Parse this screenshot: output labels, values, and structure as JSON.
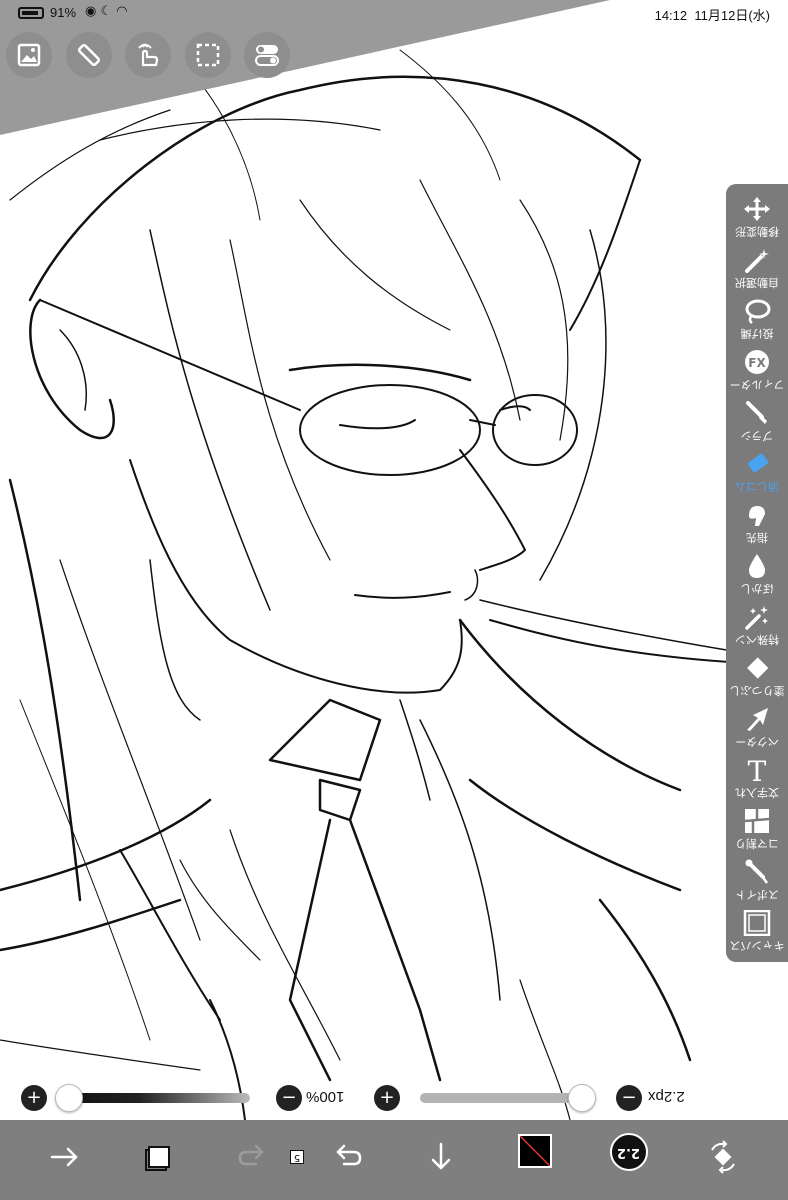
{
  "status_bar": {
    "battery_percent": "91%",
    "time": "14:12",
    "date": "11月12日(水)"
  },
  "top_tools": [
    {
      "name": "image-icon"
    },
    {
      "name": "ruler-icon"
    },
    {
      "name": "gesture-icon"
    },
    {
      "name": "selection-icon"
    },
    {
      "name": "toggle-icon"
    }
  ],
  "right_toolbar": {
    "items": [
      {
        "label": "移動変形",
        "icon": "move-icon"
      },
      {
        "label": "自動選択",
        "icon": "magic-wand-icon"
      },
      {
        "label": "投げ縄",
        "icon": "lasso-icon"
      },
      {
        "label": "フィルター",
        "icon": "fx-icon"
      },
      {
        "label": "ブラシ",
        "icon": "brush-icon"
      },
      {
        "label": "消しゴム",
        "icon": "eraser-icon",
        "active": true
      },
      {
        "label": "指先",
        "icon": "finger-icon"
      },
      {
        "label": "ぼかし",
        "icon": "blur-icon"
      },
      {
        "label": "特殊ペン",
        "icon": "special-pen-icon"
      },
      {
        "label": "塗りつぶし",
        "icon": "fill-icon"
      },
      {
        "label": "ベクター",
        "icon": "vector-icon"
      },
      {
        "label": "文字入れ",
        "icon": "text-icon"
      },
      {
        "label": "コマ割り",
        "icon": "panel-icon"
      },
      {
        "label": "スポイト",
        "icon": "eyedropper-icon"
      },
      {
        "label": "キャンバス",
        "icon": "canvas-icon"
      }
    ]
  },
  "sliders": {
    "opacity_text": "100%",
    "opacity_value": 1.0,
    "size_text": "2.2px",
    "size_value": 0.15
  },
  "bottom_bar": {
    "layer_count": "5",
    "brush_size_label": "2.2",
    "active_color": "#000000"
  }
}
